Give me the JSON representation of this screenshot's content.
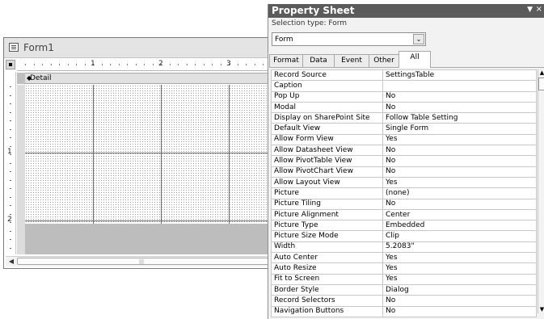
{
  "form_window": {
    "title": "Form1",
    "ruler_numbers": [
      "1",
      "2",
      "3"
    ],
    "vruler_numbers": [
      "1",
      "2"
    ],
    "section_label": "Detail",
    "section_marker": "◆"
  },
  "property_sheet": {
    "title": "Property Sheet",
    "selection_type": "Selection type:  Form",
    "selected_object": "Form",
    "tabs": [
      "Format",
      "Data",
      "Event",
      "Other",
      "All"
    ],
    "active_tab": "All",
    "properties": [
      {
        "name": "Record Source",
        "value": "SettingsTable"
      },
      {
        "name": "Caption",
        "value": ""
      },
      {
        "name": "Pop Up",
        "value": "No"
      },
      {
        "name": "Modal",
        "value": "No"
      },
      {
        "name": "Display on SharePoint Site",
        "value": "Follow Table Setting"
      },
      {
        "name": "Default View",
        "value": "Single Form"
      },
      {
        "name": "Allow Form View",
        "value": "Yes"
      },
      {
        "name": "Allow Datasheet View",
        "value": "No"
      },
      {
        "name": "Allow PivotTable View",
        "value": "No"
      },
      {
        "name": "Allow PivotChart View",
        "value": "No"
      },
      {
        "name": "Allow Layout View",
        "value": "Yes"
      },
      {
        "name": "Picture",
        "value": "(none)"
      },
      {
        "name": "Picture Tiling",
        "value": "No"
      },
      {
        "name": "Picture Alignment",
        "value": "Center"
      },
      {
        "name": "Picture Type",
        "value": "Embedded"
      },
      {
        "name": "Picture Size Mode",
        "value": "Clip"
      },
      {
        "name": "Width",
        "value": "5.2083\""
      },
      {
        "name": "Auto Center",
        "value": "Yes"
      },
      {
        "name": "Auto Resize",
        "value": "Yes"
      },
      {
        "name": "Fit to Screen",
        "value": "Yes"
      },
      {
        "name": "Border Style",
        "value": "Dialog"
      },
      {
        "name": "Record Selectors",
        "value": "No"
      },
      {
        "name": "Navigation Buttons",
        "value": "No"
      }
    ]
  },
  "icons": {
    "form_icon": "form-icon",
    "dropdown": "chevron-down-icon",
    "close": "close-icon"
  },
  "colors": {
    "ps_titlebar": "#5b5b5b",
    "grid_lines": "#6f6f6f"
  }
}
